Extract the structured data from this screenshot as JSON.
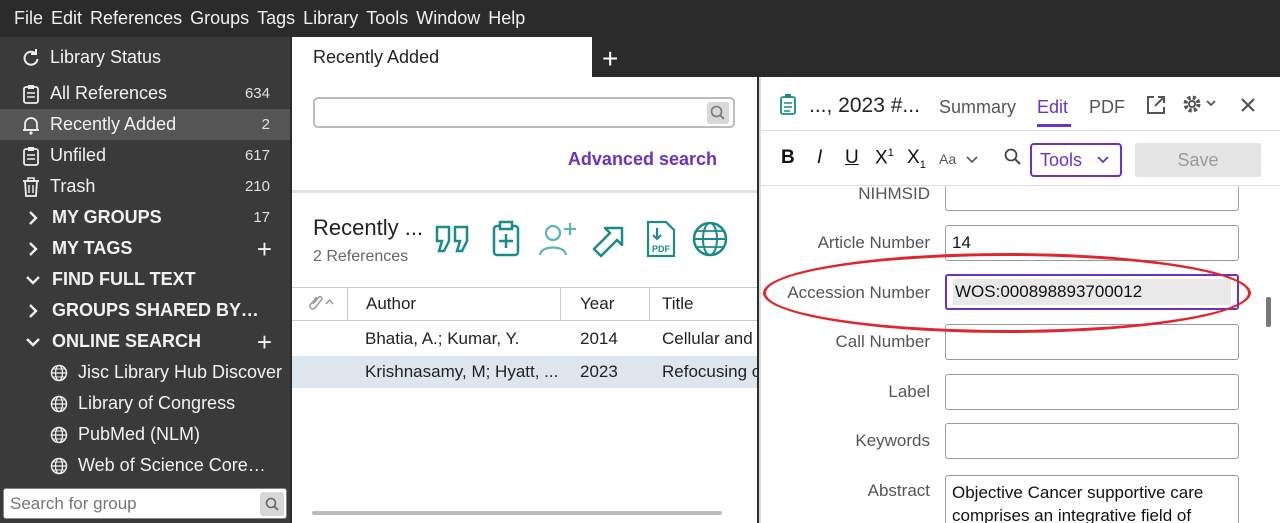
{
  "menu": [
    "File",
    "Edit",
    "References",
    "Groups",
    "Tags",
    "Library",
    "Tools",
    "Window",
    "Help"
  ],
  "sidebar": {
    "status": "Library Status",
    "items": [
      {
        "label": "All References",
        "count": "634"
      },
      {
        "label": "Recently Added",
        "count": "2"
      },
      {
        "label": "Unfiled",
        "count": "617"
      },
      {
        "label": "Trash",
        "count": "210"
      }
    ],
    "groups": [
      {
        "label": "MY GROUPS",
        "count": "17"
      },
      {
        "label": "MY TAGS",
        "count": "+"
      },
      {
        "label": "FIND FULL TEXT",
        "count": ""
      },
      {
        "label": "GROUPS SHARED BY O...",
        "count": ""
      },
      {
        "label": "ONLINE SEARCH",
        "count": "+"
      }
    ],
    "online": [
      "Jisc Library Hub Discover",
      "Library of Congress",
      "PubMed (NLM)",
      "Web of Science Core C..."
    ],
    "search_placeholder": "Search for group"
  },
  "tab": {
    "label": "Recently Added",
    "add": "+"
  },
  "middle": {
    "advanced": "Advanced search",
    "title": "Recently ...",
    "count": "2 References",
    "columns": {
      "author": "Author",
      "year": "Year",
      "title": "Title"
    },
    "rows": [
      {
        "author": "Bhatia, A.; Kumar, Y.",
        "year": "2014",
        "title": "Cellular and"
      },
      {
        "author": "Krishnasamy, M; Hyatt, ...",
        "year": "2023",
        "title": "Refocusing c"
      }
    ]
  },
  "right": {
    "title": "..., 2023 #...",
    "tabs": {
      "summary": "Summary",
      "edit": "Edit",
      "pdf": "PDF"
    },
    "format": {
      "bold": "B",
      "italic": "I",
      "underline": "U",
      "sup": "X",
      "sup_mark": "1",
      "sub": "X",
      "sub_mark": "1",
      "case": "Aa"
    },
    "tools": "Tools",
    "save": "Save",
    "fields": {
      "nihmsid": {
        "label": "NIHMSID",
        "value": ""
      },
      "article_number": {
        "label": "Article Number",
        "value": "14"
      },
      "accession_number": {
        "label": "Accession Number",
        "value": "WOS:000898893700012"
      },
      "call_number": {
        "label": "Call Number",
        "value": ""
      },
      "label": {
        "label": "Label",
        "value": ""
      },
      "keywords": {
        "label": "Keywords",
        "value": ""
      },
      "abstract": {
        "label": "Abstract",
        "value": "Objective Cancer supportive care comprises an integrative field of"
      }
    }
  },
  "colors": {
    "accent": "#6a32c9",
    "teal": "#1a8a8a",
    "annotation": "#e0262c"
  }
}
